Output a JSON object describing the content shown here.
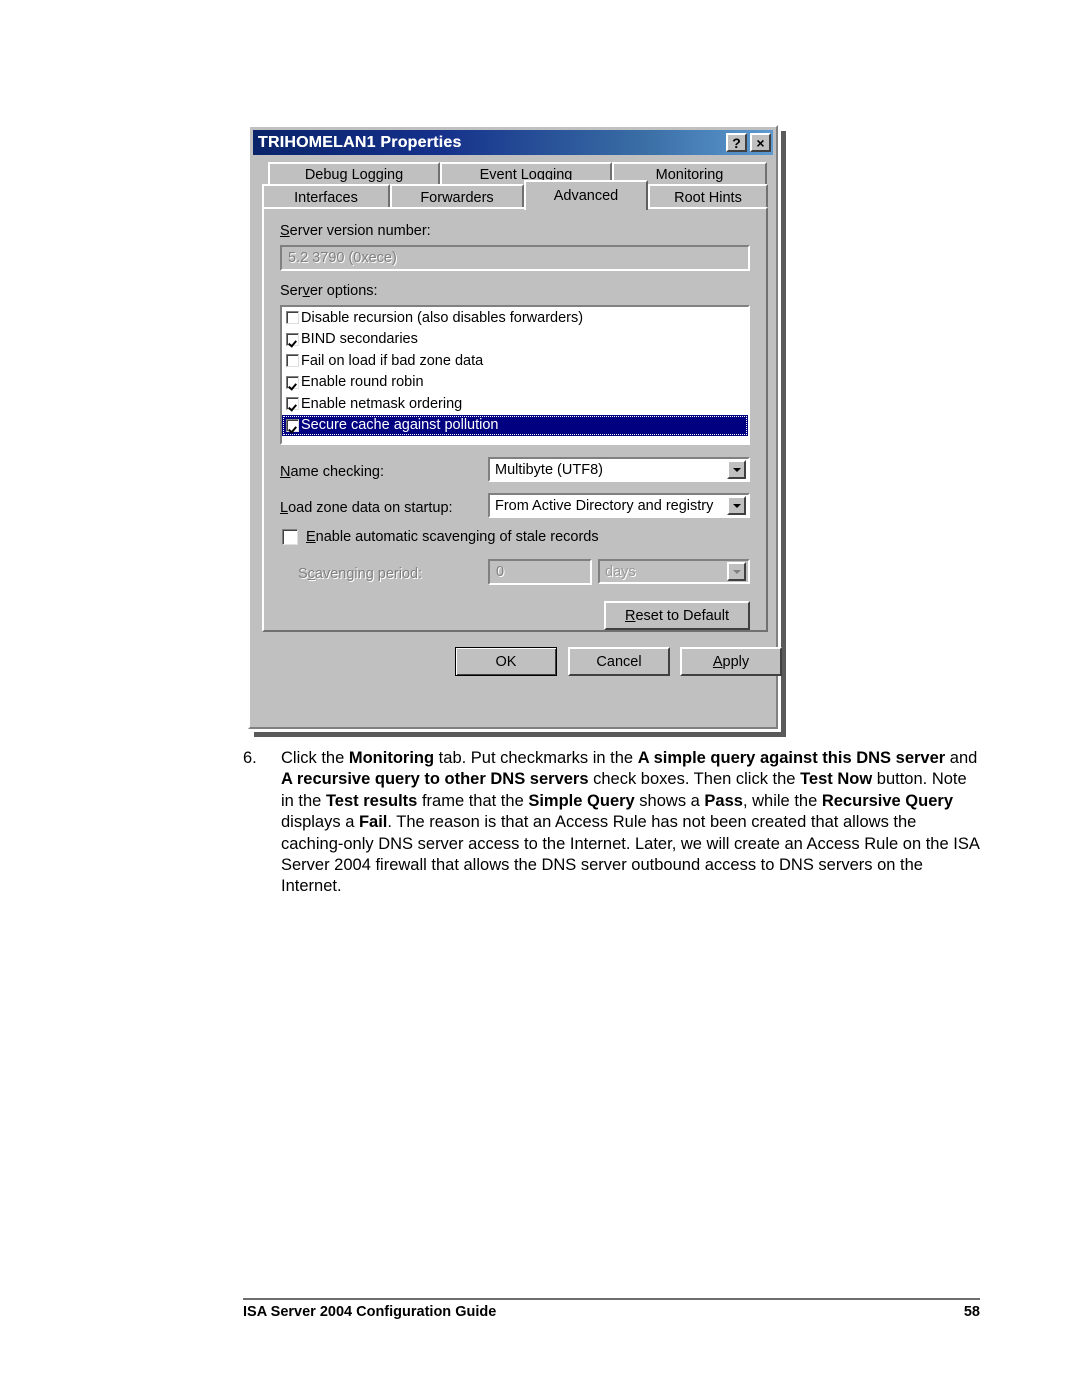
{
  "dialog": {
    "title": "TRIHOMELAN1 Properties",
    "titlebar_buttons": [
      {
        "name": "help-button",
        "glyph": "?"
      },
      {
        "name": "close-button",
        "glyph": "×"
      }
    ],
    "tabs_row1": [
      {
        "label": "Debug Logging",
        "selected": false
      },
      {
        "label": "Event Logging",
        "selected": false
      },
      {
        "label": "Monitoring",
        "selected": false
      }
    ],
    "tabs_row2": [
      {
        "label": "Interfaces",
        "selected": false
      },
      {
        "label": "Forwarders",
        "selected": false
      },
      {
        "label": "Advanced",
        "selected": true
      },
      {
        "label": "Root Hints",
        "selected": false
      }
    ],
    "server_version_label": "Server version number:",
    "server_version_value": "5.2 3790 (0xece)",
    "server_options_label": "Server options:",
    "server_options": [
      {
        "label": "Disable recursion (also disables forwarders)",
        "checked": false,
        "selected": false
      },
      {
        "label": "BIND secondaries",
        "checked": true,
        "selected": false
      },
      {
        "label": "Fail on load if bad zone data",
        "checked": false,
        "selected": false
      },
      {
        "label": "Enable round robin",
        "checked": true,
        "selected": false
      },
      {
        "label": "Enable netmask ordering",
        "checked": true,
        "selected": false
      },
      {
        "label": "Secure cache against pollution",
        "checked": true,
        "selected": true
      }
    ],
    "name_checking_label": "Name checking:",
    "name_checking_value": "Multibyte (UTF8)",
    "load_zone_label": "Load zone data on startup:",
    "load_zone_value": "From Active Directory and registry",
    "scavenging_enable_label": "Enable automatic scavenging of stale records",
    "scavenging_enabled": false,
    "scavenging_period_label": "Scavenging period:",
    "scavenging_period_value": "0",
    "scavenging_units_value": "days",
    "reset_button": "Reset to Default",
    "ok_button": "OK",
    "cancel_button": "Cancel",
    "apply_button": "Apply",
    "colors": {
      "titlebar_start": "#0a246a",
      "titlebar_end": "#5c9ad1",
      "face": "#c0c0c0",
      "highlight": "#000080",
      "field": "#ffffff",
      "disabled_text": "#808080"
    }
  },
  "step": {
    "number": "6.",
    "segments": [
      {
        "t": "Click the ",
        "b": false
      },
      {
        "t": "Monitoring",
        "b": true
      },
      {
        "t": " tab. Put checkmarks in the ",
        "b": false
      },
      {
        "t": "A simple query against this DNS server",
        "b": true
      },
      {
        "t": " and ",
        "b": false
      },
      {
        "t": "A recursive query to other DNS servers",
        "b": true
      },
      {
        "t": " check boxes. Then click the ",
        "b": false
      },
      {
        "t": "Test Now",
        "b": true
      },
      {
        "t": " button. Note in the ",
        "b": false
      },
      {
        "t": "Test results",
        "b": true
      },
      {
        "t": " frame that the ",
        "b": false
      },
      {
        "t": "Simple Query",
        "b": true
      },
      {
        "t": " shows a ",
        "b": false
      },
      {
        "t": "Pass",
        "b": true
      },
      {
        "t": ", while the ",
        "b": false
      },
      {
        "t": "Recursive Query",
        "b": true
      },
      {
        "t": " displays a ",
        "b": false
      },
      {
        "t": "Fail",
        "b": true
      },
      {
        "t": ". The reason is that an Access Rule has not been created that allows the caching-only DNS server access to the Internet. Later, we will create an Access Rule on the ISA Server 2004 firewall that allows the DNS server outbound access to DNS servers on the Internet.",
        "b": false
      }
    ]
  },
  "footer": {
    "title": "ISA Server 2004 Configuration Guide",
    "page": "58"
  }
}
